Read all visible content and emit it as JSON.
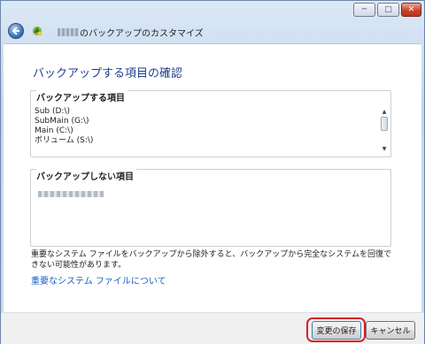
{
  "window": {
    "controls": {
      "minimize": "─",
      "maximize": "□",
      "close": "✕"
    }
  },
  "nav": {
    "title": "のバックアップのカスタマイズ"
  },
  "main": {
    "heading": "バックアップする項目の確認",
    "included": {
      "label": "バックアップする項目",
      "items": [
        "Sub (D:\\)",
        "SubMain (G:\\)",
        "Main (C:\\)",
        "ボリューム (S:\\)"
      ]
    },
    "excluded": {
      "label": "バックアップしない項目"
    },
    "warning": "重要なシステム ファイルをバックアップから除外すると、バックアップから完全なシステムを回復できない可能性があります。",
    "link": "重要なシステム ファイルについて"
  },
  "footer": {
    "save_label": "変更の保存",
    "cancel_label": "キャンセル"
  },
  "colors": {
    "heading": "#1f3f8c",
    "link": "#1a5fc4",
    "highlight": "#d4202a"
  }
}
